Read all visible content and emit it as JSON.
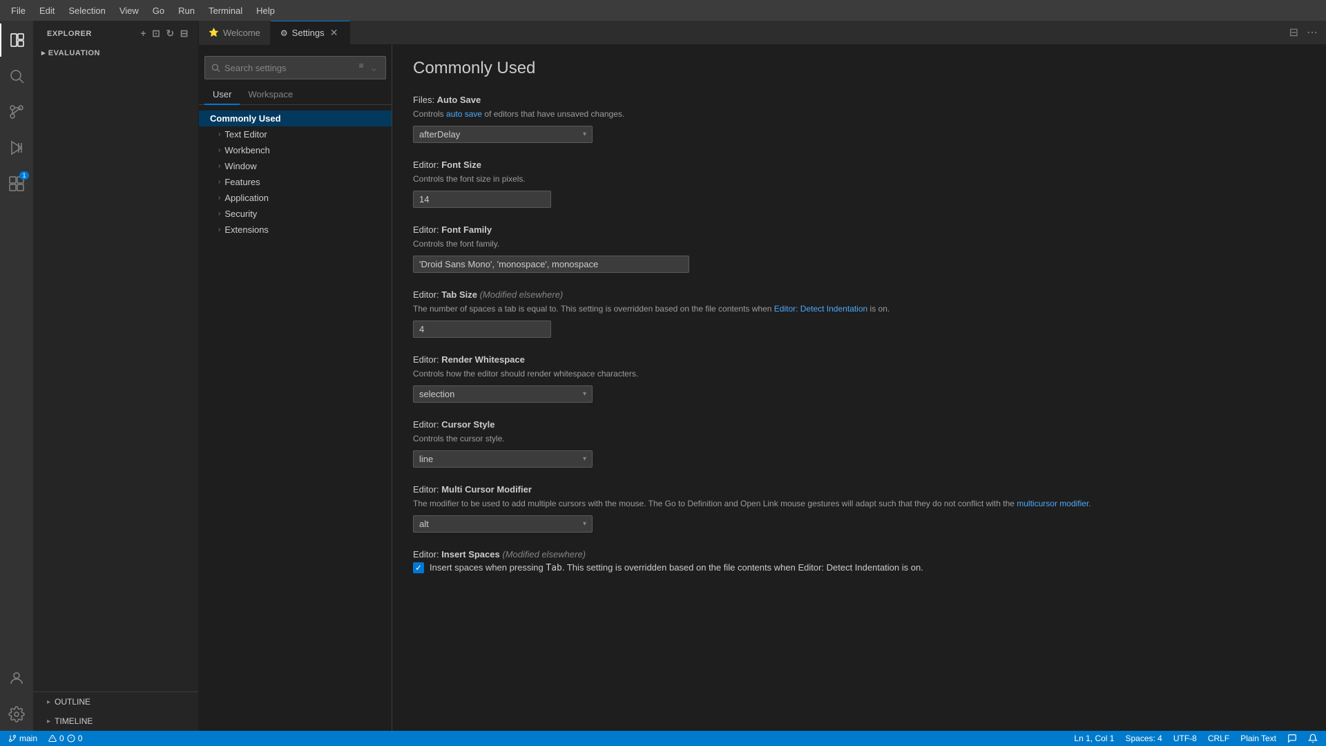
{
  "menubar": {
    "items": [
      "File",
      "Edit",
      "Selection",
      "View",
      "Go",
      "Run",
      "Terminal",
      "Help"
    ]
  },
  "activity_bar": {
    "icons": [
      {
        "name": "explorer-icon",
        "symbol": "⊞",
        "active": true
      },
      {
        "name": "search-icon",
        "symbol": "🔍",
        "active": false
      },
      {
        "name": "source-control-icon",
        "symbol": "⎇",
        "active": false
      },
      {
        "name": "run-icon",
        "symbol": "▷",
        "active": false
      },
      {
        "name": "extensions-icon",
        "symbol": "⊟",
        "active": false,
        "badge": "1"
      }
    ],
    "bottom_icons": [
      {
        "name": "account-icon",
        "symbol": "👤",
        "active": false
      },
      {
        "name": "settings-gear-icon",
        "symbol": "⚙",
        "active": false
      }
    ]
  },
  "sidebar": {
    "title": "EXPLORER",
    "section": "EVALUATION",
    "bottom_sections": [
      {
        "label": "OUTLINE"
      },
      {
        "label": "TIMELINE"
      }
    ]
  },
  "tabs": [
    {
      "label": "Welcome",
      "icon": "⭐",
      "active": false
    },
    {
      "label": "Settings",
      "icon": "⚙",
      "active": true,
      "closable": true
    }
  ],
  "settings": {
    "search_placeholder": "Search settings",
    "tabs": [
      "User",
      "Workspace"
    ],
    "active_tab": "User",
    "page_title": "Commonly Used",
    "nav_items": [
      {
        "label": "Commonly Used",
        "level": "header",
        "active": true
      },
      {
        "label": "Text Editor",
        "level": "child",
        "has_arrow": true
      },
      {
        "label": "Workbench",
        "level": "child",
        "has_arrow": true
      },
      {
        "label": "Window",
        "level": "child",
        "has_arrow": true
      },
      {
        "label": "Features",
        "level": "child",
        "has_arrow": true
      },
      {
        "label": "Application",
        "level": "child",
        "has_arrow": true
      },
      {
        "label": "Security",
        "level": "child",
        "has_arrow": true
      },
      {
        "label": "Extensions",
        "level": "child",
        "has_arrow": true
      }
    ],
    "items": [
      {
        "id": "files-auto-save",
        "label": "Files: ",
        "label_bold": "Auto Save",
        "modified": null,
        "description": "Controls {auto_save} of editors that have unsaved changes.",
        "description_link": "auto save",
        "type": "dropdown",
        "value": "afterDelay"
      },
      {
        "id": "editor-font-size",
        "label": "Editor: ",
        "label_bold": "Font Size",
        "modified": null,
        "description": "Controls the font size in pixels.",
        "type": "input",
        "value": "14"
      },
      {
        "id": "editor-font-family",
        "label": "Editor: ",
        "label_bold": "Font Family",
        "modified": null,
        "description": "Controls the font family.",
        "type": "input",
        "value": "'Droid Sans Mono', 'monospace', monospace",
        "wide": true
      },
      {
        "id": "editor-tab-size",
        "label": "Editor: ",
        "label_bold": "Tab Size",
        "modified": "(Modified elsewhere)",
        "description": "The number of spaces a tab is equal to. This setting is overridden based on the file contents when {detect_indentation} is on.",
        "description_link": "Editor: Detect Indentation",
        "type": "input",
        "value": "4"
      },
      {
        "id": "editor-render-whitespace",
        "label": "Editor: ",
        "label_bold": "Render Whitespace",
        "modified": null,
        "description": "Controls how the editor should render whitespace characters.",
        "type": "dropdown",
        "value": "selection"
      },
      {
        "id": "editor-cursor-style",
        "label": "Editor: ",
        "label_bold": "Cursor Style",
        "modified": null,
        "description": "Controls the cursor style.",
        "type": "dropdown",
        "value": "line"
      },
      {
        "id": "editor-multi-cursor-modifier",
        "label": "Editor: ",
        "label_bold": "Multi Cursor Modifier",
        "modified": null,
        "description": "The modifier to be used to add multiple cursors with the mouse. The Go to Definition and Open Link mouse gestures will adapt such that they do not conflict with the {multicursor_modifier}.",
        "description_link": "multicursor modifier",
        "type": "dropdown",
        "value": "alt"
      },
      {
        "id": "editor-insert-spaces",
        "label": "Editor: ",
        "label_bold": "Insert Spaces",
        "modified": "(Modified elsewhere)",
        "description": "Insert spaces when pressing {tab}. This setting is overridden based on the file contents when {detect_indentation} is on.",
        "description_link": "Editor: Detect Indentation",
        "type": "checkbox",
        "value": true,
        "checkbox_label": "Insert spaces when pressing"
      }
    ]
  },
  "status_bar": {
    "left": [
      {
        "label": "⎇ main",
        "name": "git-branch"
      },
      {
        "label": "⚠ 0  ⓘ 0",
        "name": "problems"
      }
    ],
    "right": [
      {
        "label": "Ln 1, Col 1",
        "name": "cursor-position"
      },
      {
        "label": "Spaces: 4",
        "name": "indentation"
      },
      {
        "label": "UTF-8",
        "name": "encoding"
      },
      {
        "label": "CRLF",
        "name": "line-endings"
      },
      {
        "label": "Plain Text",
        "name": "language-mode"
      },
      {
        "label": "⌚",
        "name": "feedback"
      }
    ]
  }
}
